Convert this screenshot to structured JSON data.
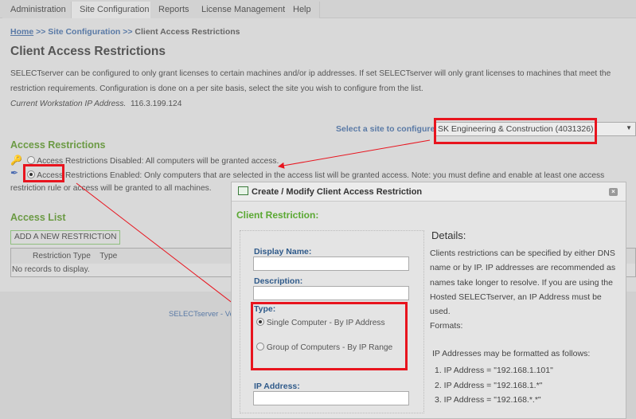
{
  "tabs": [
    "Administration",
    "Site Configuration",
    "Reports",
    "License Management",
    "Help"
  ],
  "breadcrumb": {
    "home": "Home",
    "sep": ">>",
    "site": "Site Configuration",
    "current": "Client Access Restrictions"
  },
  "page": {
    "title": "Client Access Restrictions",
    "desc1": "SELECTserver can be configured to only grant licenses to certain machines and/or ip addresses. If set SELECTserver will only grant licenses to machines that meet the",
    "desc2": "restriction requirements. Configuration is done on a per site basis, select the site you wish to configure from the list.",
    "ip_label": "Current Workstation IP Address.",
    "ip_value": "116.3.199.124"
  },
  "site_select": {
    "label": "Select a site to configure:",
    "value": "SK Engineering & Construction (4031326)"
  },
  "access_restrictions": {
    "heading": "Access Restrictions",
    "disabled": "Access Restrictions Disabled: All computers will be granted access.",
    "enabled": "Access Restrictions Enabled: Only computers that are selected in the access list will be granted access. Note: you must define and enable at least one access restriction",
    "enabled_cont": "rule or access will be granted to all machines."
  },
  "access_list": {
    "heading": "Access List",
    "add_button": "ADD A NEW RESTRICTION",
    "columns": [
      "Restriction Type",
      "Type"
    ],
    "empty": "No records to display."
  },
  "footer": {
    "text": "SELECTserver - Vers"
  },
  "modal": {
    "title": "Create / Modify Client Access Restriction",
    "section": "Client Restriction:",
    "display_name_label": "Display Name",
    "description_label": "Description",
    "type_label": "Type",
    "type_options": [
      "Single Computer - By IP Address",
      "Group of Computers - By IP Range"
    ],
    "ip_label": "IP Address",
    "details_heading": "Details:",
    "details_lines": [
      "Clients restrictions can be specified by either DNS",
      "name or by IP. IP addresses are recommended as",
      "names take longer to resolve. If you are using the",
      "Hosted SELECTserver, an IP Address must be",
      "used."
    ],
    "formats": "Formats:",
    "formats_intro": "IP Addresses may be formatted as follows:",
    "formats_list": [
      "1. IP Address = \"192.168.1.101\"",
      "2. IP Address = \"192.168.1.*\"",
      "3. IP Address = \"192.168.*.*\""
    ]
  }
}
